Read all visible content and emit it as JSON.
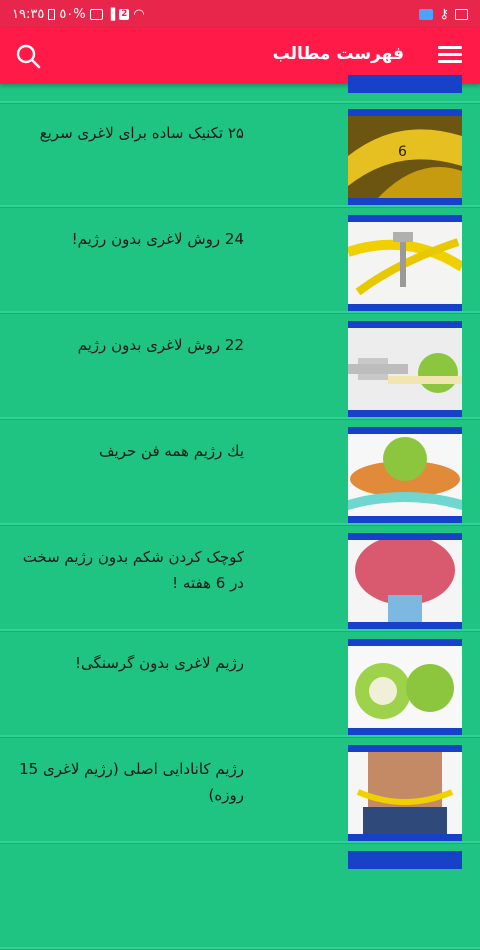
{
  "status_bar": {
    "time": "١٩:٣٥",
    "battery": "٥٠%",
    "notification_count": "2"
  },
  "app_bar": {
    "title": "فهرست مطالب",
    "menu_icon": "hamburger-menu-icon",
    "search_icon": "search-icon"
  },
  "articles": [
    {
      "title": "۲۵ تکنیک ساده برای لاغری سریع",
      "image": "measuring-tape-closeup"
    },
    {
      "title": "24 روش لاغری بدون رژیم!",
      "image": "fork-with-measuring-tape"
    },
    {
      "title": "22 روش لاغری بدون رژیم",
      "image": "apple-and-dumbbell"
    },
    {
      "title": "یك رژیم همه فن حریف",
      "image": "apple-with-tape-on-plate"
    },
    {
      "title": "کوچک کردن شکم بدون رژیم سخت در 6 هفته !",
      "image": "belly-on-scale"
    },
    {
      "title": "رژیم لاغری بدون گرسنگی!",
      "image": "green-apple-with-scale"
    },
    {
      "title": "رژیم کانادایی اصلی (رژیم لاغری 15 روزه)",
      "image": "abs-with-measuring-tape"
    }
  ]
}
